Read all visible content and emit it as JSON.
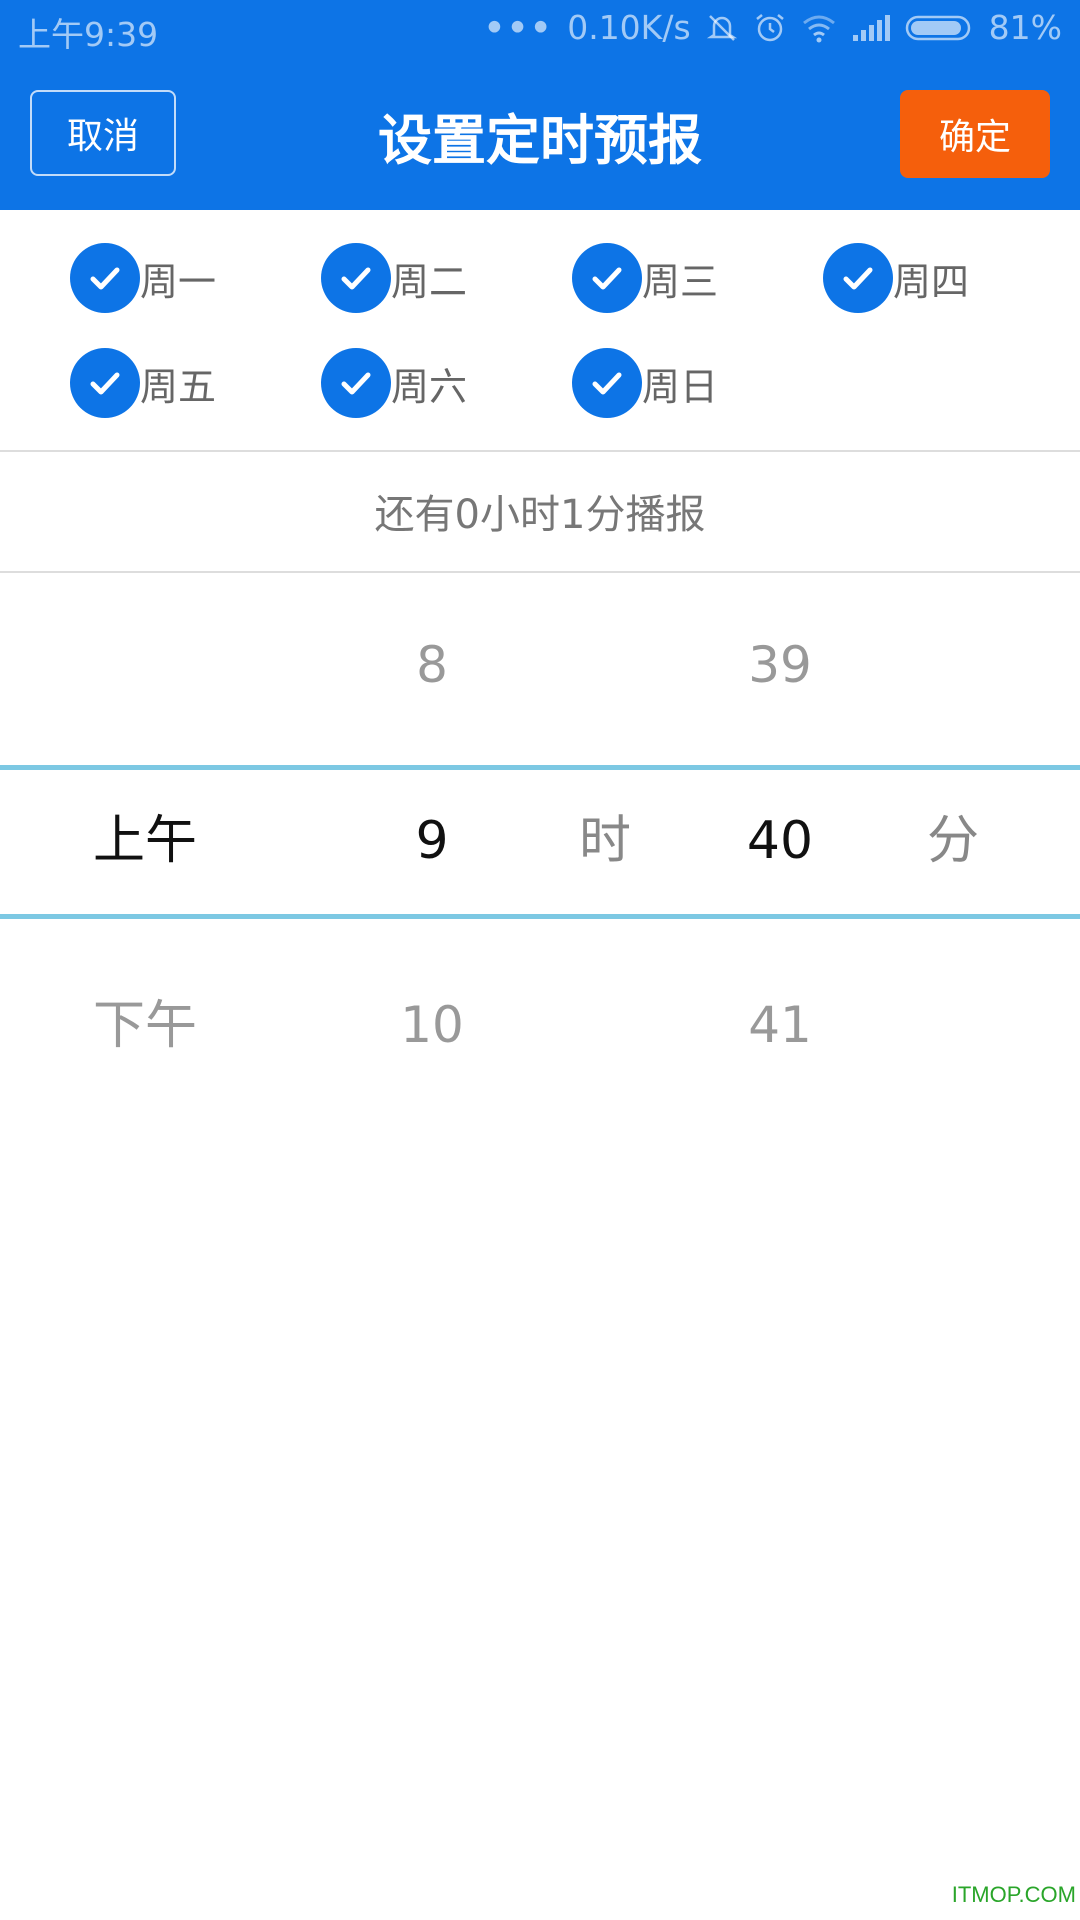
{
  "status_bar": {
    "time": "上午9:39",
    "net_speed": "0.10K/s",
    "battery": "81%"
  },
  "header": {
    "cancel_label": "取消",
    "title": "设置定时预报",
    "confirm_label": "确定"
  },
  "weekdays": [
    {
      "label": "周一",
      "checked": true
    },
    {
      "label": "周二",
      "checked": true
    },
    {
      "label": "周三",
      "checked": true
    },
    {
      "label": "周四",
      "checked": true
    },
    {
      "label": "周五",
      "checked": true
    },
    {
      "label": "周六",
      "checked": true
    },
    {
      "label": "周日",
      "checked": true
    }
  ],
  "countdown": "还有0小时1分播报",
  "picker": {
    "period": {
      "selected": "上午",
      "next": "下午"
    },
    "hour": {
      "prev": "8",
      "selected": "9",
      "next": "10"
    },
    "hour_unit": "时",
    "minute": {
      "prev": "39",
      "selected": "40",
      "next": "41"
    },
    "minute_unit": "分"
  },
  "watermark": "ITMOP.COM",
  "colors": {
    "primary": "#0d74e6",
    "confirm": "#f55f0c",
    "selection_line": "#7cc8e3"
  }
}
